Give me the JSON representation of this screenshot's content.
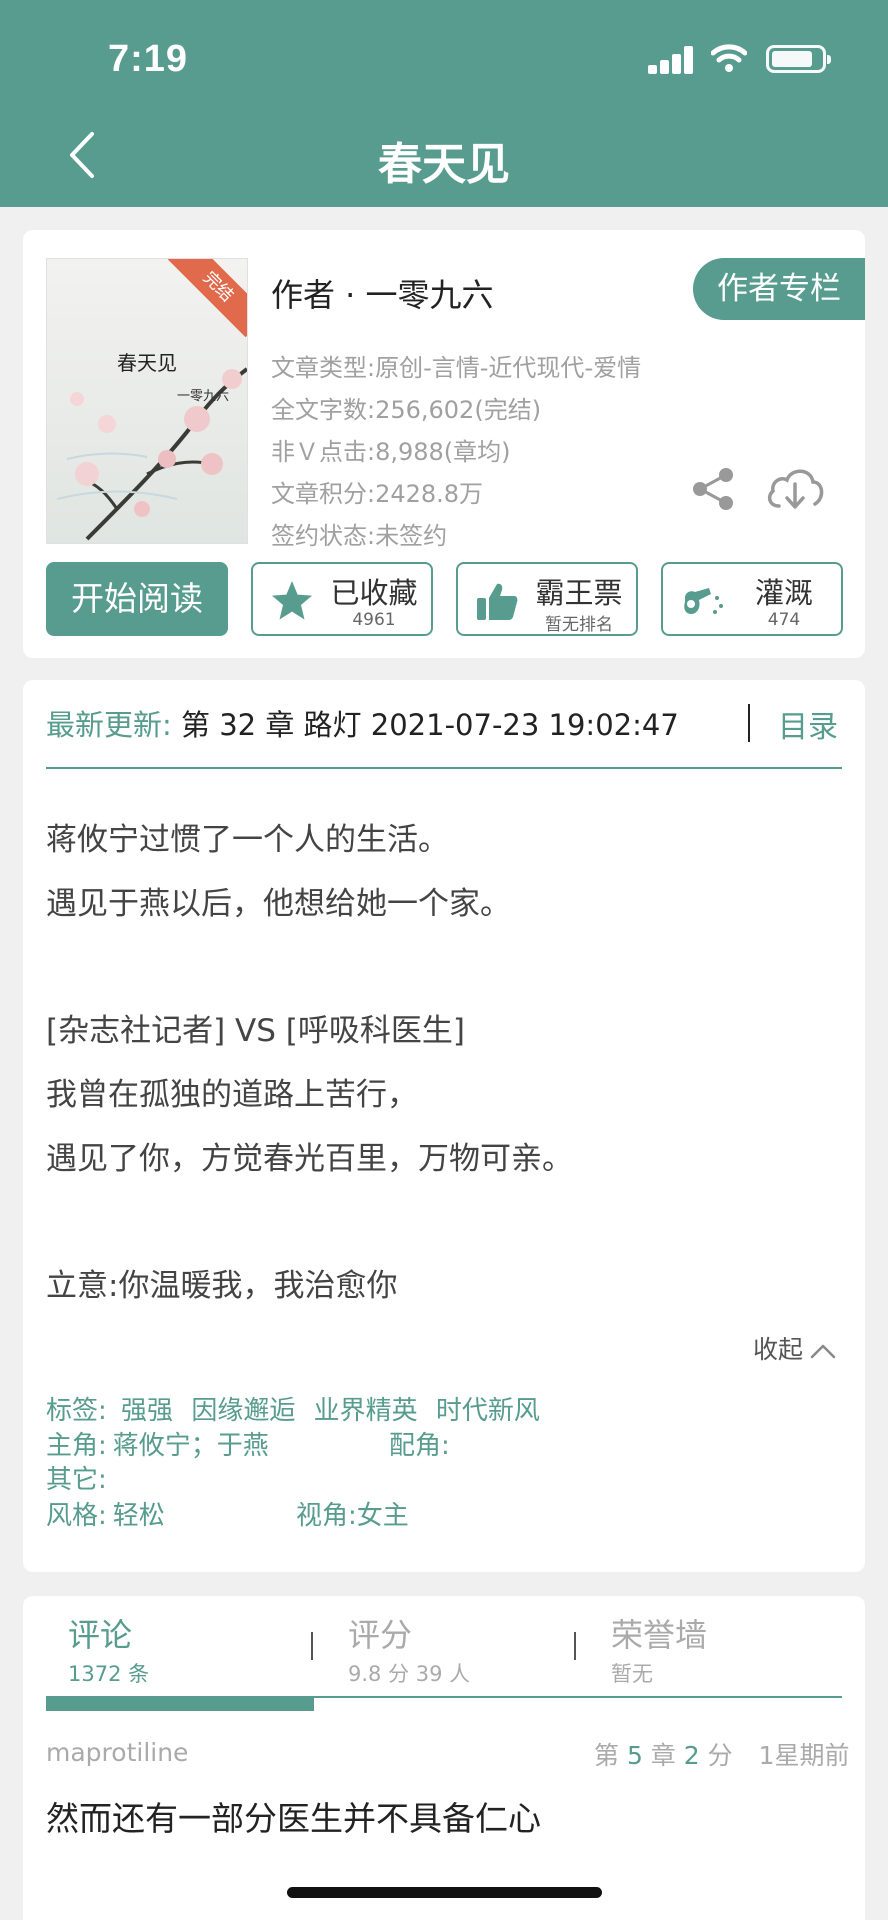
{
  "status": {
    "time": "7:19"
  },
  "header": {
    "title": "春天见"
  },
  "book": {
    "cover_badge": "完结",
    "cover_title": "春天见",
    "cover_author": "一零九六",
    "author_line": "作者 · 一零九六",
    "author_column_label": "作者专栏",
    "meta": [
      "文章类型:原创-言情-近代现代-爱情",
      "全文字数:256,602(完结)",
      "非Ｖ点击:8,988(章均)",
      "文章积分:2428.8万",
      "签约状态:未签约"
    ],
    "start_reading": "开始阅读",
    "favorite": {
      "label": "已收藏",
      "sub": "4961"
    },
    "ticket": {
      "label": "霸王票",
      "sub": "暂无排名"
    },
    "water": {
      "label": "灌溉",
      "sub": "474"
    }
  },
  "update": {
    "label": "最新更新:",
    "text": " 第 32 章 路灯 2021-07-23 19:02:47",
    "toc": "目录"
  },
  "intro": [
    "蒋攸宁过惯了一个人的生活。",
    "遇见于燕以后，他想给她一个家。",
    "[杂志社记者] VS [呼吸科医生]",
    "我曾在孤独的道路上苦行，",
    "遇见了你，方觉春光百里，万物可亲。",
    "立意:你温暖我，我治愈你"
  ],
  "collapse_label": "收起",
  "info": {
    "tags_label": "标签:",
    "tags": [
      "强强",
      "因缘邂逅",
      "业界精英",
      "时代新风"
    ],
    "lead_label": "主角:",
    "lead": "蒋攸宁；于燕",
    "support_label": "配角:",
    "other_label": "其它:",
    "style_label": "风格:",
    "style": "轻松",
    "view_label": "视角:",
    "view": "女主"
  },
  "tabs": [
    {
      "title": "评论",
      "sub": "1372 条"
    },
    {
      "title": "评分",
      "sub": "9.8 分 39 人"
    },
    {
      "title": "荣誉墙",
      "sub": "暂无"
    }
  ],
  "comment": {
    "user": "maprotiline",
    "chapter_prefix": "第 ",
    "chapter_num": "5",
    "chapter_suffix": " 章 ",
    "score_num": "2",
    "score_suffix": " 分",
    "time": "1星期前",
    "text": "然而还有一部分医生并不具备仁心"
  },
  "colors": {
    "accent": "#579c8e",
    "badge": "#e06a4b"
  }
}
